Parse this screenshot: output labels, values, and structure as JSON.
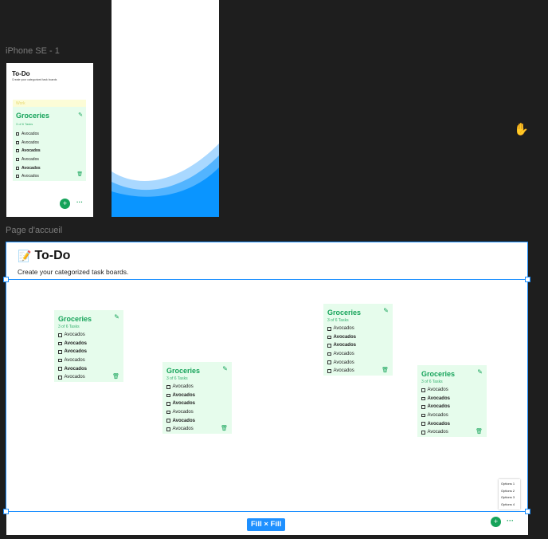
{
  "frames": {
    "iphone_label": "iPhone SE - 1",
    "page_label": "Page d'accueil"
  },
  "iphone": {
    "title": "To-Do",
    "subtitle": "Create your categorized task boards",
    "category": "Work",
    "board": {
      "title": "Groceries",
      "subtitle": "3 of 6 Tasks",
      "items": [
        "Avocados",
        "Avocados",
        "Avocados",
        "Avocados",
        "Avocados",
        "Avocados"
      ]
    },
    "fab": "+",
    "more": "···"
  },
  "page": {
    "title": "To-Do",
    "emoji": "📝",
    "subtitle": "Create your categorized task boards.",
    "boards": [
      {
        "title": "Groceries",
        "subtitle": "3 of 6 Tasks",
        "items": [
          "Avocados",
          "Avocados",
          "Avocados",
          "Avocados",
          "Avocados",
          "Avocados"
        ]
      },
      {
        "title": "Groceries",
        "subtitle": "3 of 6 Tasks",
        "items": [
          "Avocados",
          "Avocados",
          "Avocados",
          "Avocados",
          "Avocados",
          "Avocados"
        ]
      },
      {
        "title": "Groceries",
        "subtitle": "3 of 6 Tasks",
        "items": [
          "Avocados",
          "Avocados",
          "Avocados",
          "Avocados",
          "Avocados",
          "Avocados"
        ]
      },
      {
        "title": "Groceries",
        "subtitle": "3 of 6 Tasks",
        "items": [
          "Avocados",
          "Avocados",
          "Avocados",
          "Avocados",
          "Avocados",
          "Avocados"
        ]
      }
    ],
    "options": [
      "Options 1",
      "Options 2",
      "Options 3",
      "Options 4"
    ],
    "fab": "+",
    "more": "···"
  },
  "selection": {
    "size_label": "Fill × Fill"
  },
  "colors": {
    "canvas": "#1e1e1e",
    "selection": "#1e90ff",
    "accent_green": "#16a35a",
    "board_bg": "#e6fcec",
    "wave": "#0a95ff"
  },
  "icons": {
    "edit": "pencil-icon",
    "delete": "trash-icon",
    "cursor": "hand-cursor-icon"
  }
}
